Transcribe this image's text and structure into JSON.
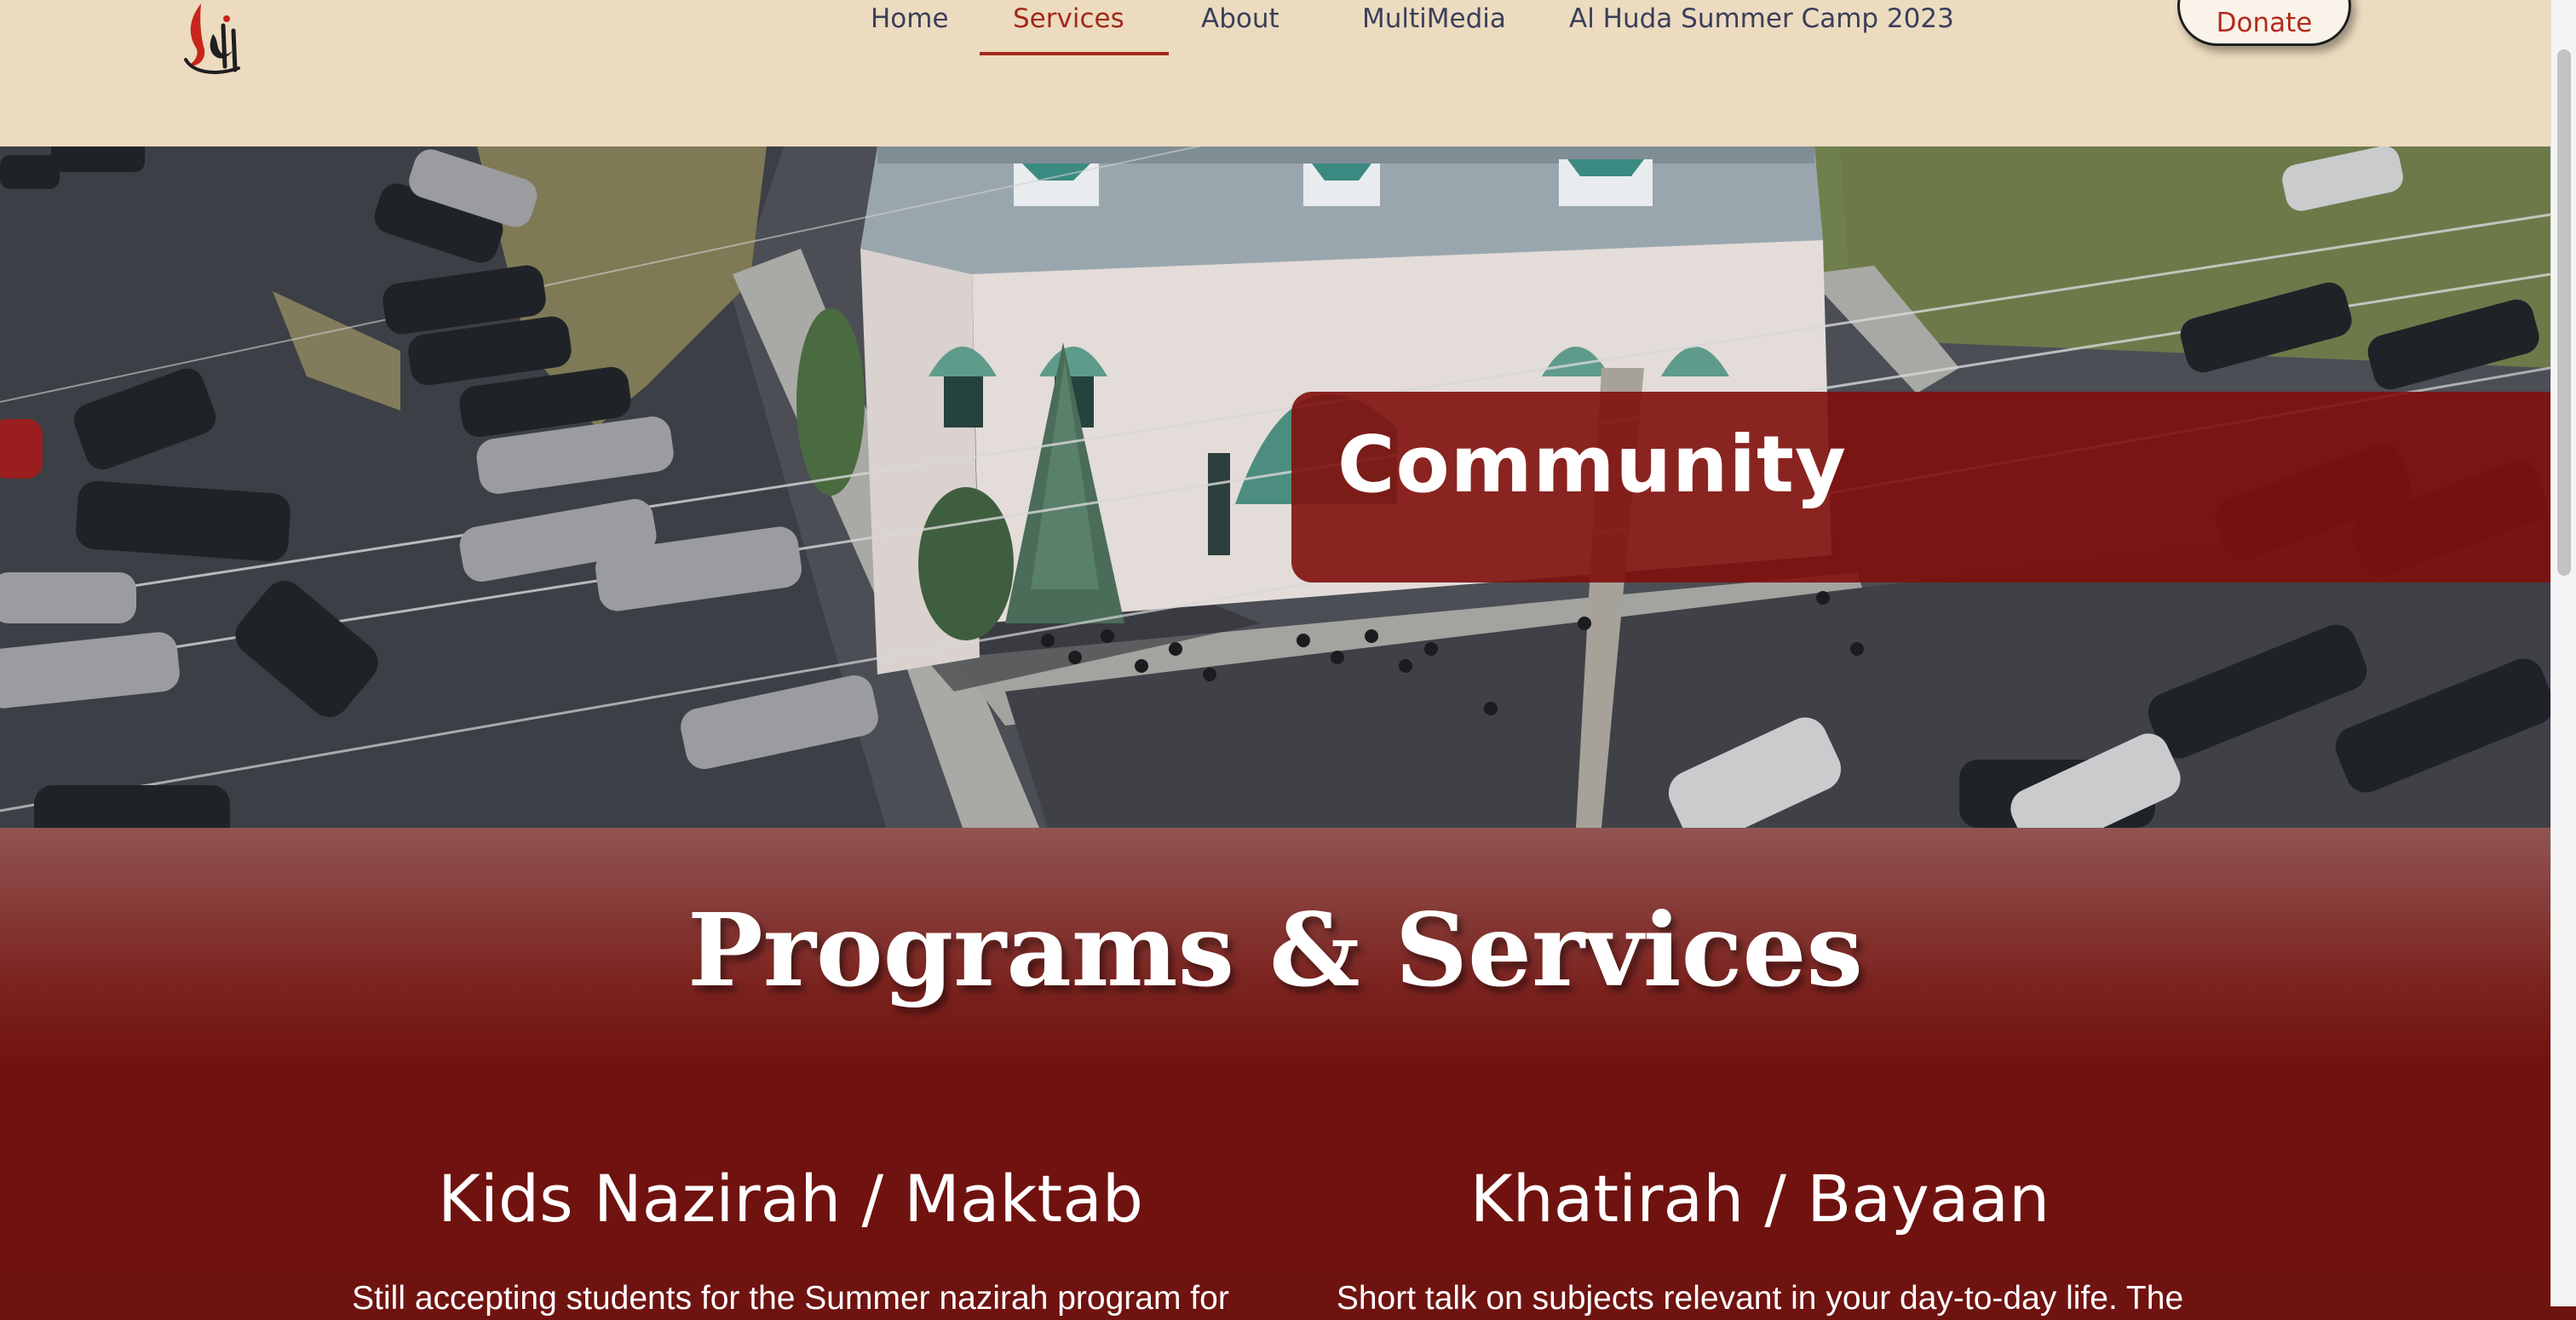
{
  "header": {
    "logo_icon": "al-huda-calligraphy-logo",
    "nav": [
      {
        "label": "Home",
        "active": false
      },
      {
        "label": "Services",
        "active": true
      },
      {
        "label": "About",
        "active": false
      },
      {
        "label": "MultiMedia",
        "active": false
      },
      {
        "label": "Al Huda Summer Camp 2023",
        "active": false
      }
    ],
    "donate_label": "Donate"
  },
  "hero": {
    "banner_title": "Community",
    "image_description_icon": "mosque-aerial-photo"
  },
  "programs": {
    "title": "Programs & Services",
    "items": [
      {
        "title": "Kids Nazirah / Maktab",
        "description": "Still accepting students for the Summer nazirah program for"
      },
      {
        "title": "Khatirah / Bayaan",
        "description": "Short talk on subjects relevant in your day-to-day life. The"
      }
    ]
  },
  "colors": {
    "header_bg": "#ecdbbf",
    "accent": "#a3281b",
    "nav_text": "#3a3f5a",
    "programs_bg": "#6f1310",
    "banner_bg": "#80100c"
  }
}
